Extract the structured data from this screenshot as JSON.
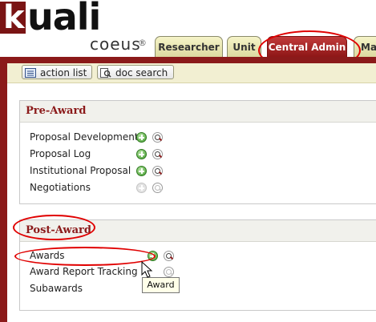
{
  "brand": {
    "logo_k": "k",
    "logo_rest": "uali",
    "product": "coeus",
    "reg_mark": "®"
  },
  "tabs": [
    {
      "label": "Researcher",
      "active": false
    },
    {
      "label": "Unit",
      "active": false
    },
    {
      "label": "Central Admin",
      "active": true
    },
    {
      "label": "Mai",
      "active": false
    }
  ],
  "toolbar": {
    "action_list": "action list",
    "doc_search": "doc search"
  },
  "pre_award": {
    "title": "Pre-Award",
    "items": [
      {
        "label": "Proposal Development",
        "enabled": true
      },
      {
        "label": "Proposal Log",
        "enabled": true
      },
      {
        "label": "Institutional Proposal",
        "enabled": true
      },
      {
        "label": "Negotiations",
        "enabled": false
      }
    ]
  },
  "post_award": {
    "title": "Post-Award",
    "items": [
      {
        "label": "Awards",
        "enabled": true
      },
      {
        "label": "Award Report Tracking",
        "enabled": false
      },
      {
        "label": "Subawards",
        "enabled": false
      }
    ]
  },
  "tooltip": "Award",
  "colors": {
    "brand_red": "#8b1a1a",
    "tab_active": "#a82525",
    "highlight": "#e00000"
  }
}
